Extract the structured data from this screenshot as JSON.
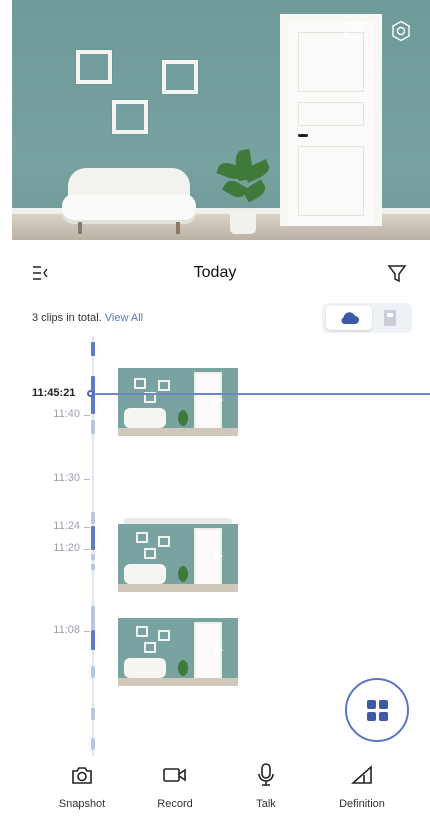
{
  "live_view": {
    "icons": [
      "external-open-icon",
      "settings-icon"
    ]
  },
  "header": {
    "title": "Today",
    "left_icon": "list-view-icon",
    "right_icon": "filter-icon"
  },
  "clips": {
    "summary": "3 clips in total.",
    "view_all": "View All"
  },
  "storage_toggle": {
    "options": [
      "cloud-icon",
      "sd-card-icon"
    ],
    "selected": "cloud",
    "accent": "#3c5aa8"
  },
  "timeline": {
    "current_time": "11:45:21",
    "ticks": [
      "11:40",
      "11:30",
      "11:24",
      "11:20",
      "11:08"
    ],
    "clip_count": 3
  },
  "fab": {
    "icon": "grid-icon"
  },
  "toolbar": {
    "items": [
      {
        "label": "Snapshot",
        "icon": "camera-icon"
      },
      {
        "label": "Record",
        "icon": "video-camera-icon"
      },
      {
        "label": "Talk",
        "icon": "microphone-icon"
      },
      {
        "label": "Definition",
        "icon": "signal-definition-icon"
      }
    ]
  },
  "colors": {
    "accent": "#5b76c6",
    "timeline_line": "#6f86c4"
  }
}
